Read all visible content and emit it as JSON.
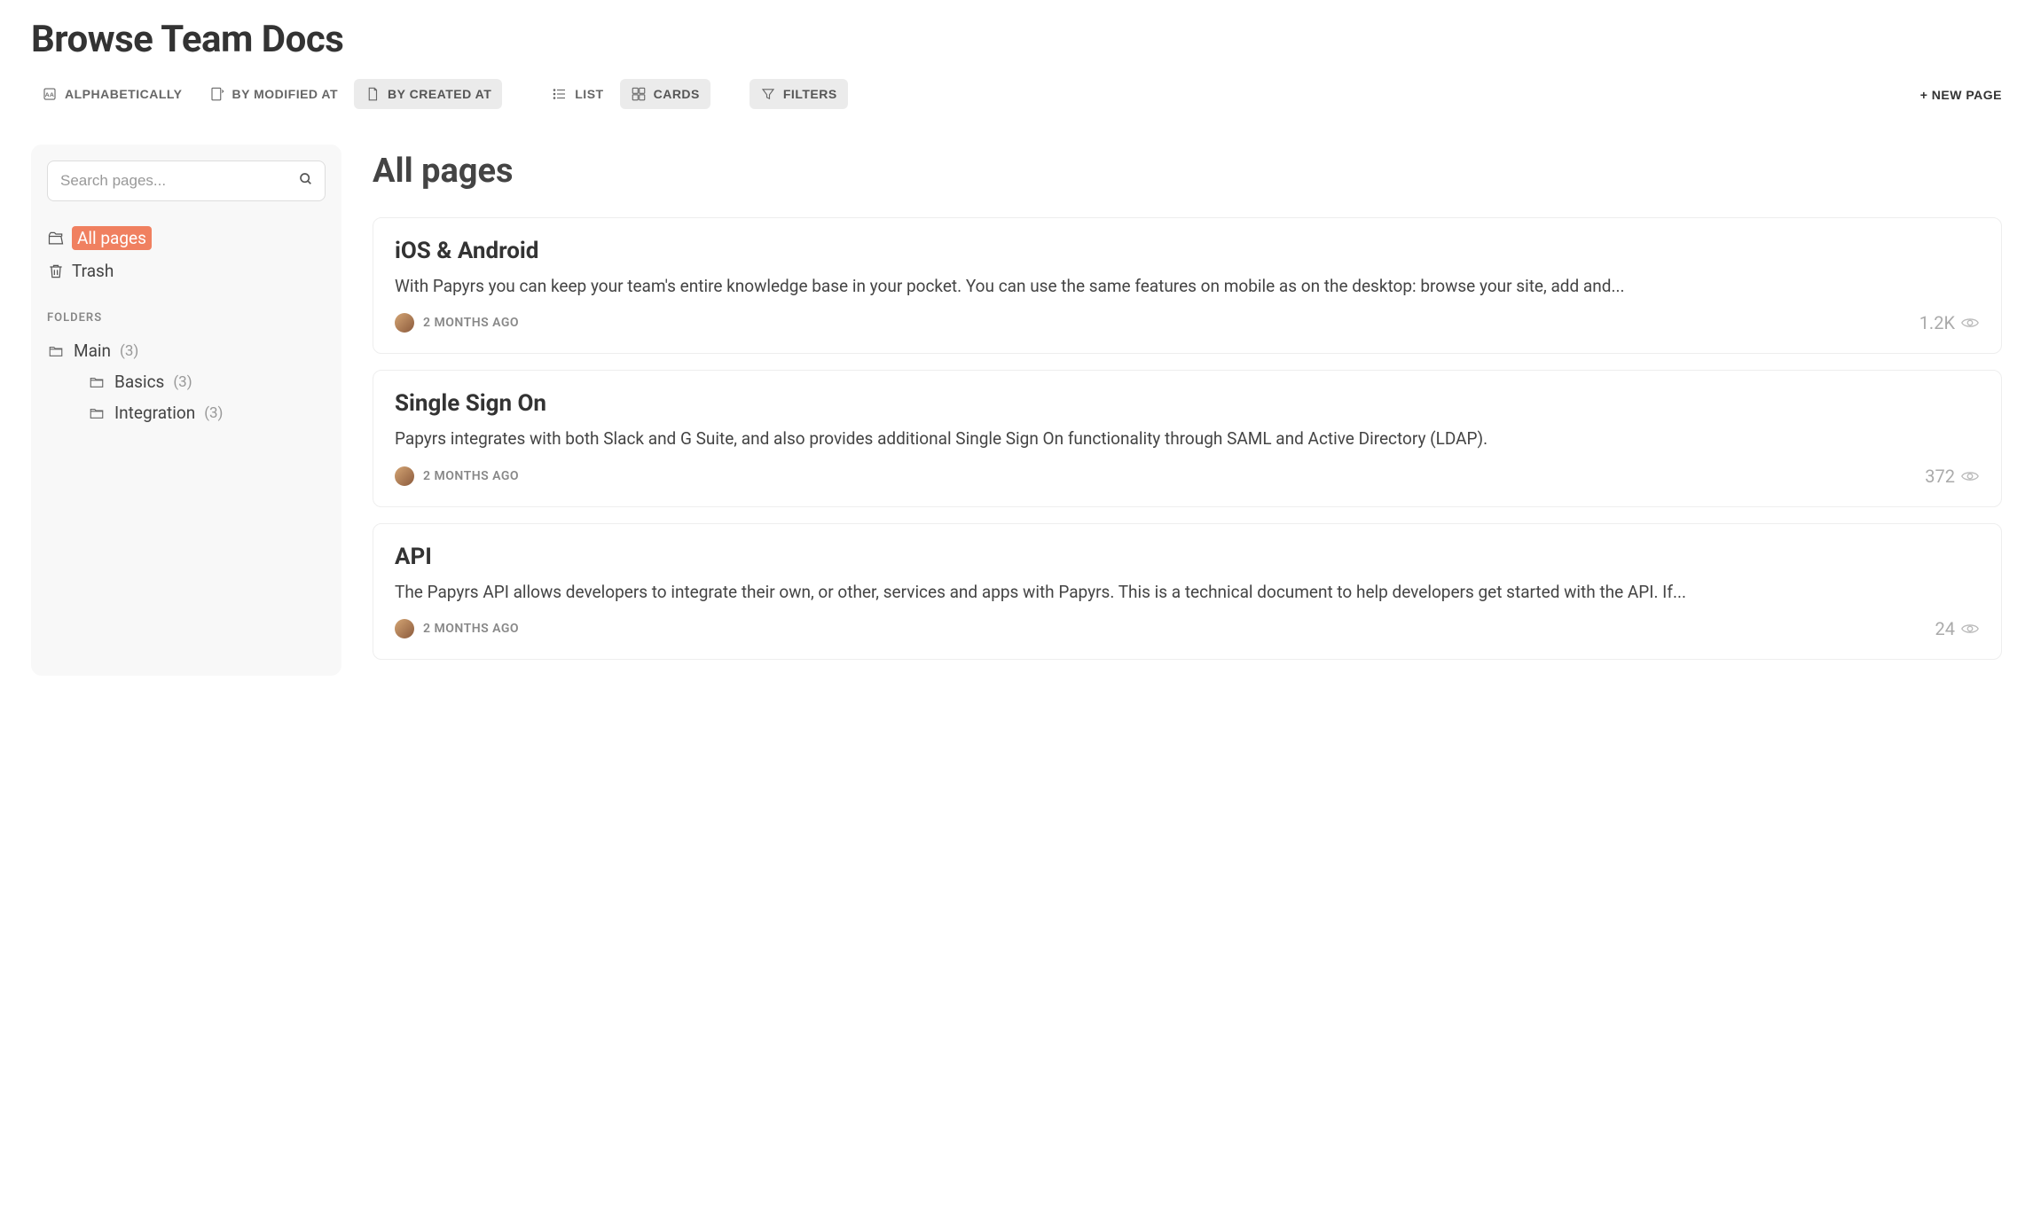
{
  "header": {
    "title": "Browse Team Docs"
  },
  "toolbar": {
    "sort": {
      "alphabetically": "Alphabetically",
      "by_modified": "By Modified At",
      "by_created": "By Created At"
    },
    "view": {
      "list": "List",
      "cards": "Cards"
    },
    "filters": "Filters",
    "new_page": "+ NEW PAGE"
  },
  "sidebar": {
    "search_placeholder": "Search pages...",
    "all_pages": "All pages",
    "trash": "Trash",
    "folders_header": "Folders",
    "folders": [
      {
        "name": "Main",
        "count": "(3)"
      },
      {
        "name": "Basics",
        "count": "(3)"
      },
      {
        "name": "Integration",
        "count": "(3)"
      }
    ]
  },
  "main": {
    "heading": "All pages",
    "cards": [
      {
        "title": "iOS & Android",
        "body": "With Papyrs you can keep your team's entire knowledge base in your pocket. You can use the same features on mobile as on the desktop: browse your site, add and...",
        "time": "2 months ago",
        "views": "1.2K"
      },
      {
        "title": "Single Sign On",
        "body": "Papyrs integrates with both Slack and G Suite, and also provides additional Single Sign On functionality through SAML and Active Directory (LDAP).",
        "time": "2 months ago",
        "views": "372"
      },
      {
        "title": "API",
        "body": "The Papyrs API allows developers to integrate their own, or other, services and apps with Papyrs. This is a technical document to help developers get started with the API. If...",
        "time": "2 months ago",
        "views": "24"
      }
    ]
  }
}
